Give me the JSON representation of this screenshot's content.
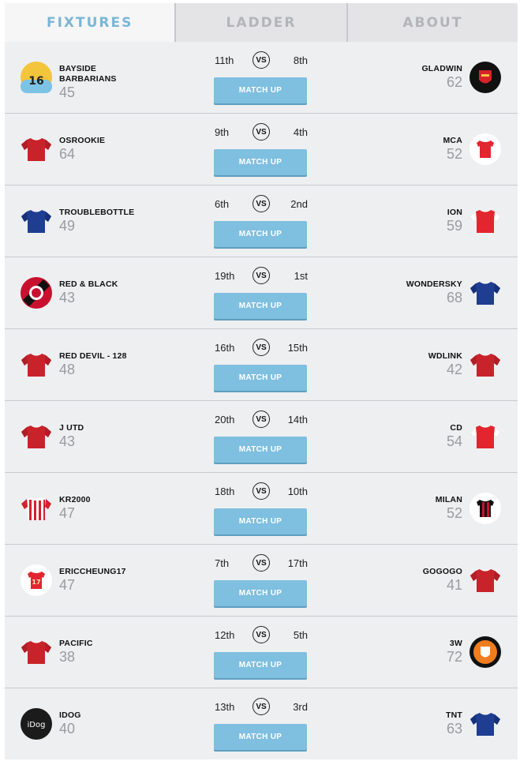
{
  "tabs": [
    {
      "label": "FIXTURES",
      "active": true
    },
    {
      "label": "LADDER",
      "active": false
    },
    {
      "label": "ABOUT",
      "active": false
    }
  ],
  "vs_label": "VS",
  "button_label": "MATCH UP",
  "colors": {
    "accent": "#7fbfe0",
    "active_tab_text": "#7ab6d6",
    "inactive_tab_text": "#b3b5b8",
    "score_grey": "#9a9b9e"
  },
  "fixtures": [
    {
      "home": {
        "name": "BAYSIDE BARBARIANS",
        "score": "45",
        "rank": "11th",
        "icon": "yellow-jersey-16-icon"
      },
      "away": {
        "name": "GLADWIN",
        "score": "62",
        "rank": "8th",
        "icon": "arsenal-crest-icon"
      }
    },
    {
      "home": {
        "name": "OSROOKIE",
        "score": "64",
        "rank": "9th",
        "icon": "red-jersey-icon"
      },
      "away": {
        "name": "MCA",
        "score": "52",
        "rank": "4th",
        "icon": "red-white-shirt-icon"
      }
    },
    {
      "home": {
        "name": "TROUBLEBOTTLE",
        "score": "49",
        "rank": "6th",
        "icon": "blue-jersey-icon"
      },
      "away": {
        "name": "ION",
        "score": "59",
        "rank": "2nd",
        "icon": "red-white-jersey-icon"
      }
    },
    {
      "home": {
        "name": "RED & BLACK",
        "score": "43",
        "rank": "19th",
        "icon": "ac-milan-crest-icon"
      },
      "away": {
        "name": "WONDERSKY",
        "score": "68",
        "rank": "1st",
        "icon": "blue-jersey-icon"
      }
    },
    {
      "home": {
        "name": "RED DEVIL - 128",
        "score": "48",
        "rank": "16th",
        "icon": "red-jersey-icon"
      },
      "away": {
        "name": "WDLINK",
        "score": "42",
        "rank": "15th",
        "icon": "red-jersey-icon"
      }
    },
    {
      "home": {
        "name": "J UTD",
        "score": "43",
        "rank": "20th",
        "icon": "red-jersey-icon"
      },
      "away": {
        "name": "CD",
        "score": "54",
        "rank": "14th",
        "icon": "red-white-jersey-icon"
      }
    },
    {
      "home": {
        "name": "KR2000",
        "score": "47",
        "rank": "18th",
        "icon": "red-white-striped-jersey-icon"
      },
      "away": {
        "name": "MILAN",
        "score": "52",
        "rank": "10th",
        "icon": "milan-striped-shirt-icon"
      }
    },
    {
      "home": {
        "name": "ERICCHEUNG17",
        "score": "47",
        "rank": "7th",
        "icon": "red-shirt-17-icon"
      },
      "away": {
        "name": "GOGOGO",
        "score": "41",
        "rank": "17th",
        "icon": "red-jersey-icon"
      }
    },
    {
      "home": {
        "name": "PACIFIC",
        "score": "38",
        "rank": "12th",
        "icon": "red-jersey-icon"
      },
      "away": {
        "name": "3W",
        "score": "72",
        "rank": "5th",
        "icon": "knvb-crest-icon"
      }
    },
    {
      "home": {
        "name": "IDOG",
        "score": "40",
        "rank": "13th",
        "icon": "idog-logo-icon"
      },
      "away": {
        "name": "TNT",
        "score": "63",
        "rank": "3rd",
        "icon": "blue-jersey-icon"
      }
    }
  ]
}
